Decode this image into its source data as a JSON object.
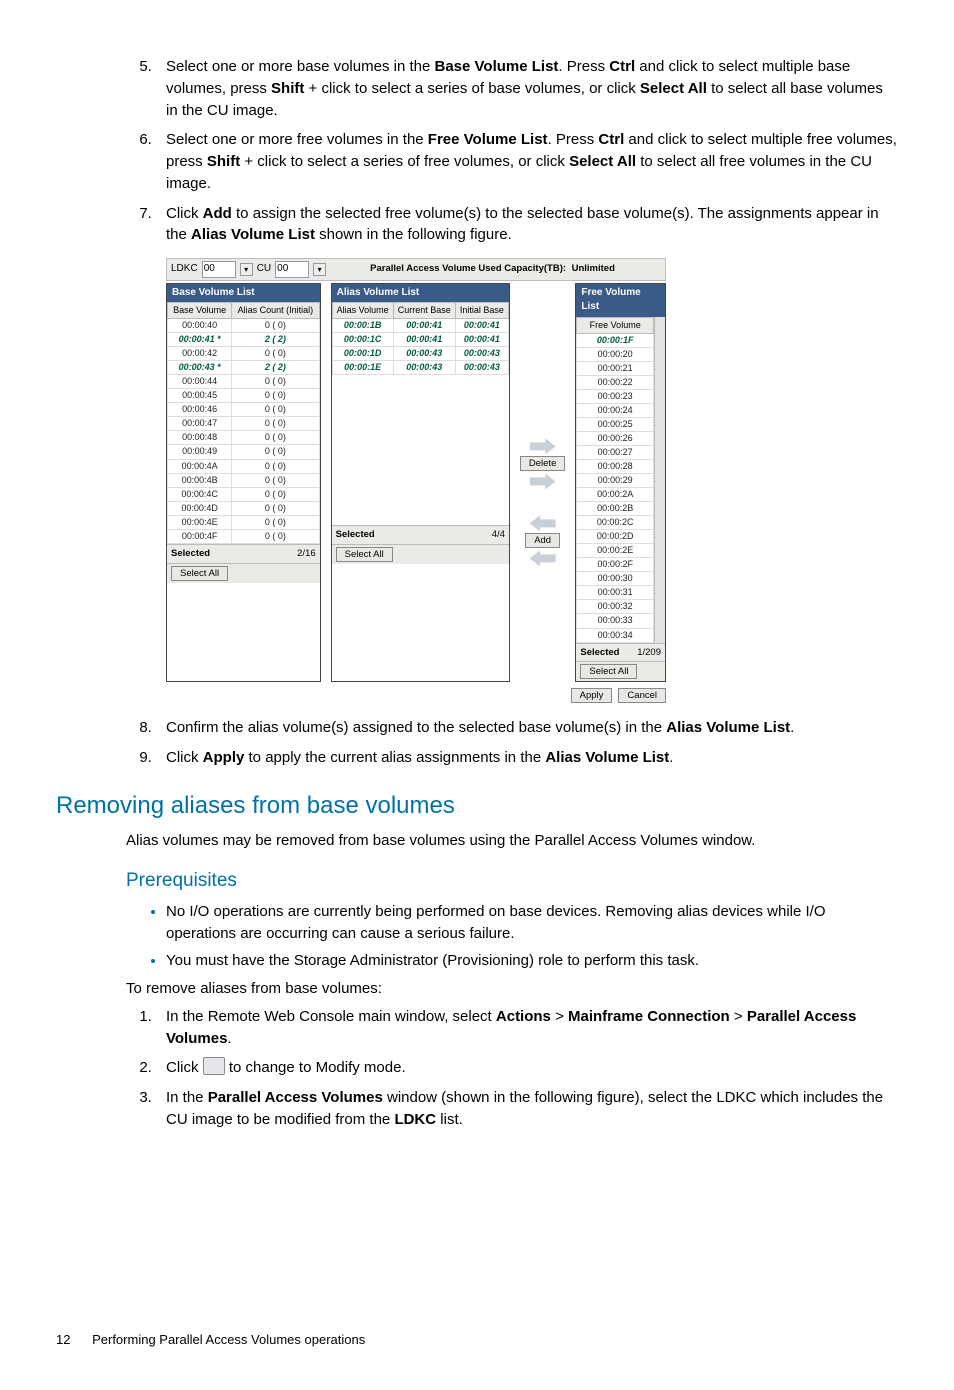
{
  "steps_top": {
    "s5": [
      "Select one or more base volumes in the ",
      "Base Volume List",
      ". Press ",
      "Ctrl",
      " and click to select multiple base volumes, press ",
      "Shift",
      " + click to select a series of base volumes, or click ",
      "Select All",
      " to select all base volumes in the CU image."
    ],
    "s6": [
      "Select one or more free volumes in the ",
      "Free Volume List",
      ". Press ",
      "Ctrl",
      " and click to select multiple free volumes, press ",
      "Shift",
      " + click to select a series of free volumes, or click ",
      "Select All",
      " to select all free volumes in the CU image."
    ],
    "s7": [
      "Click ",
      "Add",
      " to assign the selected free volume(s) to the selected base volume(s). The assignments appear in the ",
      "Alias Volume List",
      " shown in the following figure."
    ],
    "s8": [
      "Confirm the alias volume(s) assigned to the selected base volume(s) in the ",
      "Alias Volume List",
      "."
    ],
    "s9": [
      "Click ",
      "Apply",
      " to apply the current alias assignments in the ",
      "Alias Volume List",
      "."
    ]
  },
  "section": "Removing aliases from base volumes",
  "section_intro": "Alias volumes may be removed from base volumes using the Parallel Access Volumes window.",
  "prereq_head": "Prerequisites",
  "prereq_bullets": [
    "No I/O operations are currently being performed on base devices. Removing alias devices while I/O operations are occurring can cause a serious failure.",
    "You must have the Storage Administrator (Provisioning) role to perform this task."
  ],
  "remove_intro": "To remove aliases from base volumes:",
  "remove_steps": {
    "s1": [
      "In the Remote Web Console main window, select ",
      "Actions",
      " > ",
      "Mainframe Connection",
      " > ",
      "Parallel Access Volumes",
      "."
    ],
    "s2a": "Click ",
    "s2b": " to change to Modify mode.",
    "s3": [
      "In the ",
      "Parallel Access Volumes",
      " window (shown in the following figure), select the LDKC which includes the CU image to be modified from the ",
      "LDKC",
      " list."
    ]
  },
  "footer": {
    "page": "12",
    "chapter": "Performing Parallel Access Volumes operations"
  },
  "fig": {
    "ldkc_label": "LDKC",
    "ldkc_val": "00",
    "cu_label": "CU",
    "cu_val": "00",
    "capacity_label": "Parallel Access Volume Used Capacity(TB):",
    "capacity_val": "Unlimited",
    "base_head": "Base Volume List",
    "alias_head": "Alias Volume List",
    "free_head": "Free Volume List",
    "base_cols": [
      "Base Volume",
      "Alias Count (Initial)"
    ],
    "base_rows": [
      {
        "v": "00:00:40",
        "c": "0 ( 0)",
        "hl": false
      },
      {
        "v": "00:00:41 *",
        "c": "2 ( 2)",
        "hl": true
      },
      {
        "v": "00:00:42",
        "c": "0 ( 0)",
        "hl": false
      },
      {
        "v": "00:00:43 *",
        "c": "2 ( 2)",
        "hl": true
      },
      {
        "v": "00:00:44",
        "c": "0 ( 0)",
        "hl": false
      },
      {
        "v": "00:00:45",
        "c": "0 ( 0)",
        "hl": false
      },
      {
        "v": "00:00:46",
        "c": "0 ( 0)",
        "hl": false
      },
      {
        "v": "00:00:47",
        "c": "0 ( 0)",
        "hl": false
      },
      {
        "v": "00:00:48",
        "c": "0 ( 0)",
        "hl": false
      },
      {
        "v": "00:00:49",
        "c": "0 ( 0)",
        "hl": false
      },
      {
        "v": "00:00:4A",
        "c": "0 ( 0)",
        "hl": false
      },
      {
        "v": "00:00:4B",
        "c": "0 ( 0)",
        "hl": false
      },
      {
        "v": "00:00:4C",
        "c": "0 ( 0)",
        "hl": false
      },
      {
        "v": "00:00:4D",
        "c": "0 ( 0)",
        "hl": false
      },
      {
        "v": "00:00:4E",
        "c": "0 ( 0)",
        "hl": false
      },
      {
        "v": "00:00:4F",
        "c": "0 ( 0)",
        "hl": false
      }
    ],
    "alias_cols": [
      "Alias Volume",
      "Current Base",
      "Initial Base"
    ],
    "alias_rows": [
      {
        "a": "00:00:1B",
        "cb": "00:00:41",
        "ib": "00:00:41"
      },
      {
        "a": "00:00:1C",
        "cb": "00:00:41",
        "ib": "00:00:41"
      },
      {
        "a": "00:00:1D",
        "cb": "00:00:43",
        "ib": "00:00:43"
      },
      {
        "a": "00:00:1E",
        "cb": "00:00:43",
        "ib": "00:00:43"
      }
    ],
    "free_col": "Free Volume",
    "free_rows": [
      "00:00:1F",
      "00:00:20",
      "00:00:21",
      "00:00:22",
      "00:00:23",
      "00:00:24",
      "00:00:25",
      "00:00:26",
      "00:00:27",
      "00:00:28",
      "00:00:29",
      "00:00:2A",
      "00:00:2B",
      "00:00:2C",
      "00:00:2D",
      "00:00:2E",
      "00:00:2F",
      "00:00:30",
      "00:00:31",
      "00:00:32",
      "00:00:33",
      "00:00:34"
    ],
    "delete_btn": "Delete",
    "add_btn": "Add",
    "selected": "Selected",
    "selectall": "Select All",
    "base_count": "2/16",
    "alias_count": "4/4",
    "free_count": "1/209",
    "apply": "Apply",
    "cancel": "Cancel"
  }
}
